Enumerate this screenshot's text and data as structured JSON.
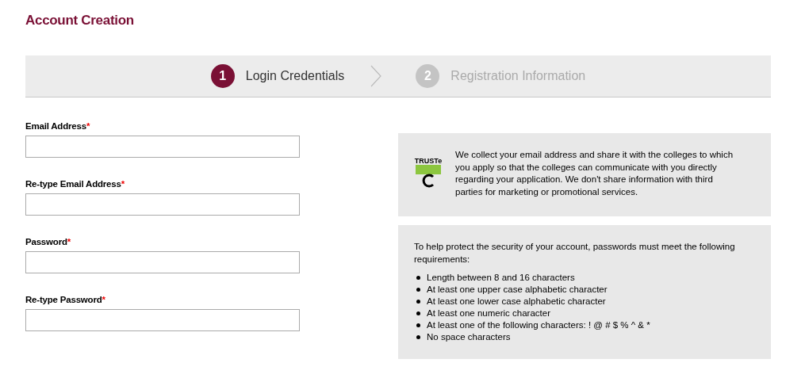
{
  "title": "Account Creation",
  "steps": [
    {
      "number": "1",
      "label": "Login Credentials",
      "selected": true
    },
    {
      "number": "2",
      "label": "Registration Information",
      "selected": false
    }
  ],
  "fields": [
    {
      "label": "Email Address",
      "required_mark": "*"
    },
    {
      "label": "Re-type Email Address",
      "required_mark": "*"
    },
    {
      "label": "Password",
      "required_mark": "*"
    },
    {
      "label": "Re-type Password",
      "required_mark": "*"
    }
  ],
  "privacy": {
    "badge": "TRUSTe",
    "text": "We collect your email address and share it with the colleges to which you apply so that the colleges can communicate with you directly regarding your application. We don't share information with third parties for marketing or promotional services."
  },
  "password_rules": {
    "intro": "To help protect the security of your account, passwords must meet the following requirements:",
    "items": [
      "Length between 8 and 16 characters",
      "At least one upper case alphabetic character",
      "At least one lower case alphabetic character",
      "At least one numeric character",
      "At least one of the following characters: ! @ # $ % ^ & *",
      "No space characters"
    ]
  }
}
